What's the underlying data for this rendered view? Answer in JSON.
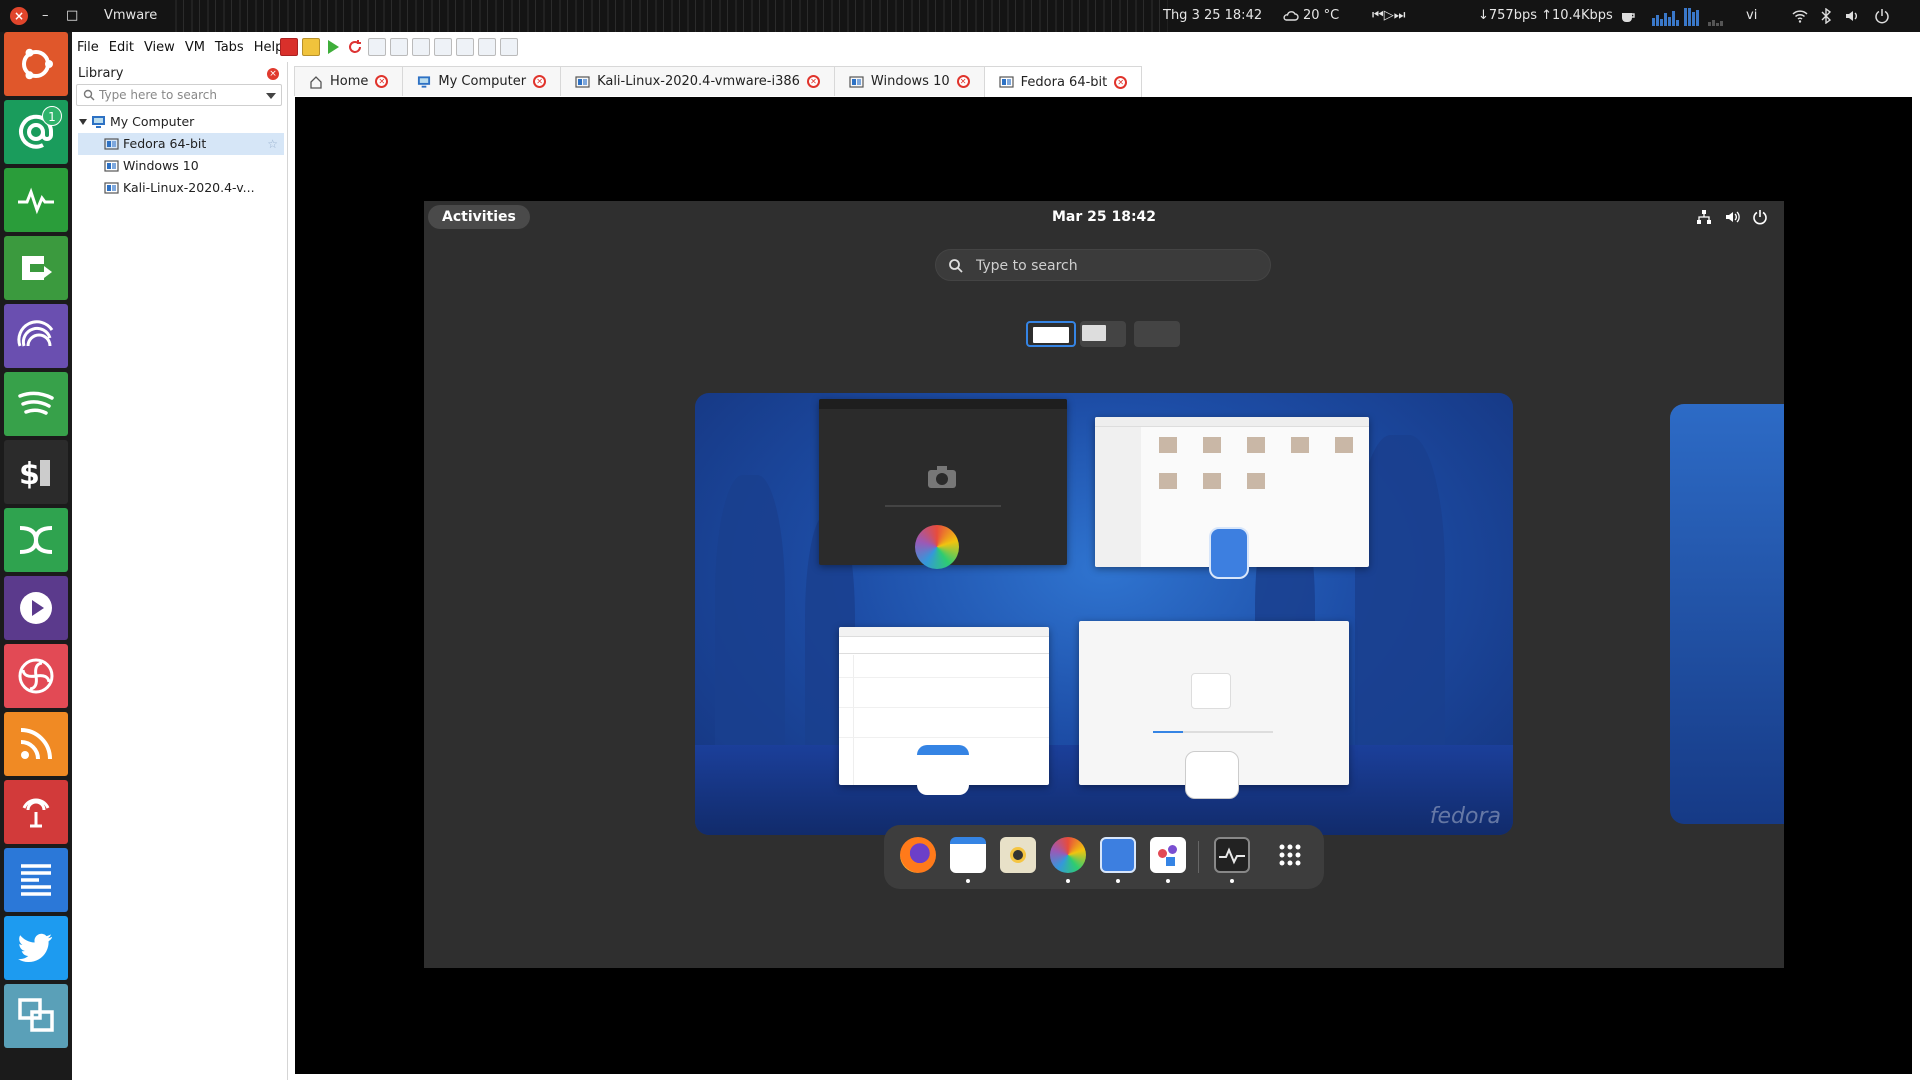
{
  "top_panel": {
    "app_title": "Vmware",
    "date_time": "Thg 3 25  18:42",
    "weather": "20 °C",
    "media_controls": "⏮▷⏭",
    "network_speed": "↓757bps ↑10.4Kbps",
    "language": "vi",
    "icons": [
      "close-icon",
      "minimize-icon",
      "maximize-icon",
      "cloud-icon",
      "coffee-icon",
      "wifi-icon",
      "bluetooth-icon",
      "volume-icon",
      "power-icon"
    ]
  },
  "launcher": {
    "items": [
      {
        "name": "ubuntu",
        "color": "#e0572b"
      },
      {
        "name": "mail",
        "color": "#1a9c5c",
        "badge": "1"
      },
      {
        "name": "system-monitor",
        "color": "#2a9d3a"
      },
      {
        "name": "update",
        "color": "#3b9a3e"
      },
      {
        "name": "audio-waves",
        "color": "#6a4fb0"
      },
      {
        "name": "spotify",
        "color": "#37a14a"
      },
      {
        "name": "terminal-money",
        "color": "#2b2b2b"
      },
      {
        "name": "crossover",
        "color": "#2fa34f"
      },
      {
        "name": "media-player",
        "color": "#5b3a8c"
      },
      {
        "name": "fan",
        "color": "#e24a55"
      },
      {
        "name": "rss",
        "color": "#f08a24"
      },
      {
        "name": "remote",
        "color": "#d23a3a"
      },
      {
        "name": "text-editor",
        "color": "#2b78d8"
      },
      {
        "name": "twitter",
        "color": "#1d9bf0"
      },
      {
        "name": "virtual-manager",
        "color": "#5aa0b8"
      }
    ]
  },
  "menu": [
    "File",
    "Edit",
    "View",
    "VM",
    "Tabs",
    "Help"
  ],
  "library": {
    "title": "Library",
    "search_placeholder": "Type here to search",
    "root": "My Computer",
    "vms": [
      "Fedora 64-bit",
      "Windows 10",
      "Kali-Linux-2020.4-v..."
    ]
  },
  "tabs": [
    {
      "label": "Home",
      "active": false
    },
    {
      "label": "My Computer",
      "active": false
    },
    {
      "label": "Kali-Linux-2020.4-vmware-i386",
      "active": false
    },
    {
      "label": "Windows 10",
      "active": false
    },
    {
      "label": "Fedora 64-bit",
      "active": true
    }
  ],
  "guest": {
    "activities_label": "Activities",
    "clock": "Mar 25  18:42",
    "search_placeholder": "Type to search",
    "watermark": "fedora",
    "windows": [
      "screenshot-window",
      "files-window",
      "calendar-window",
      "software-window"
    ],
    "dash_apps": [
      "firefox",
      "calendar",
      "rhythmbox",
      "photos",
      "files",
      "software",
      "system-monitor",
      "show-apps"
    ]
  },
  "colors": {
    "accent": "#3584e4",
    "vmware_close": "#e0342c",
    "selection": "#d6e6f7"
  }
}
